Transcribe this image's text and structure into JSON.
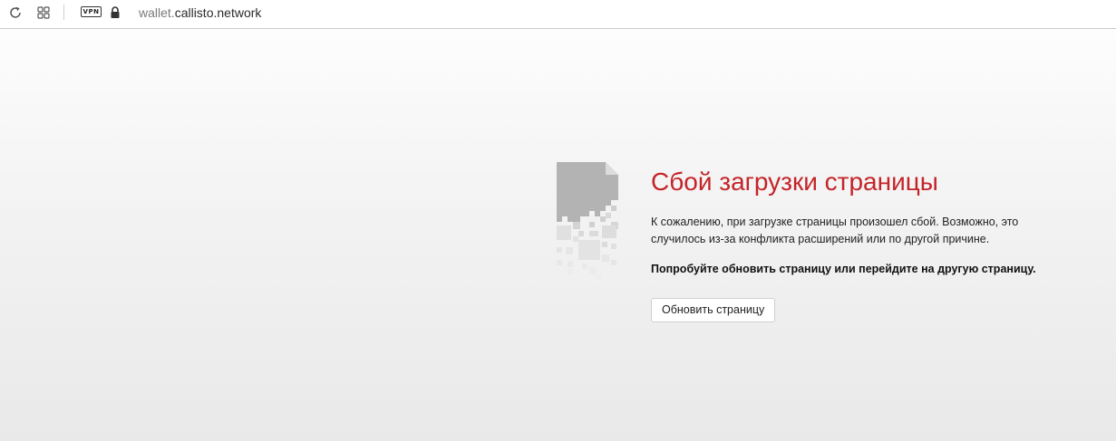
{
  "browser": {
    "url": {
      "subdomain": "wallet.",
      "domain": "callisto.network"
    },
    "vpn_badge": "VPN",
    "icons": {
      "reload": "reload-icon",
      "tabs": "tabs-grid-icon",
      "lock": "lock-icon"
    }
  },
  "error_page": {
    "illustration": "broken-page-icon",
    "title": "Сбой загрузки страницы",
    "description": "К сожалению, при загрузке страницы произошел сбой. Возможно, это случилось из-за конфликта расширений или по другой причине.",
    "hint": "Попробуйте обновить страницу или перейдите на другую страницу.",
    "reload_button": "Обновить страницу"
  },
  "colors": {
    "title": "#c42428",
    "illustration_dark": "#b3b3b3",
    "illustration_light": "#d8d8d8"
  }
}
